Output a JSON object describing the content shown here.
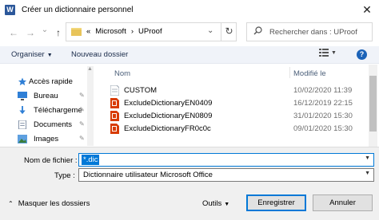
{
  "window": {
    "app_icon_letter": "W",
    "title": "Créer un dictionnaire personnel",
    "close_symbol": "✕"
  },
  "navigation": {
    "back_symbol": "←",
    "forward_symbol": "→",
    "history_symbol": "⌄",
    "up_symbol": "↑",
    "breadcrumb": [
      "«",
      "Microsoft",
      "›",
      "UProof"
    ],
    "refresh_symbol": "↻",
    "search_placeholder": "Rechercher dans : UProof"
  },
  "toolbar": {
    "organize_label": "Organiser",
    "new_folder_label": "Nouveau dossier",
    "help_symbol": "?"
  },
  "nav_pane": {
    "items": [
      {
        "label": "Accès rapide",
        "icon": "star-icon",
        "pinned": false
      },
      {
        "label": "Bureau",
        "icon": "desktop-icon",
        "pinned": true
      },
      {
        "label": "Téléchargeme",
        "icon": "download-icon",
        "pinned": true
      },
      {
        "label": "Documents",
        "icon": "documents-icon",
        "pinned": true
      },
      {
        "label": "Images",
        "icon": "images-icon",
        "pinned": true
      }
    ],
    "pin_symbol": "📌"
  },
  "file_list": {
    "columns": {
      "name": "Nom",
      "date": "Modifié le"
    },
    "files": [
      {
        "name": "CUSTOM",
        "date": "10/02/2020 11:39",
        "icon": "text-file-icon"
      },
      {
        "name": "ExcludeDictionaryEN0409",
        "date": "16/12/2019 22:15",
        "icon": "office-file-icon"
      },
      {
        "name": "ExcludeDictionaryEN0809",
        "date": "31/01/2020 15:30",
        "icon": "office-file-icon"
      },
      {
        "name": "ExcludeDictionaryFR0c0c",
        "date": "09/01/2020 15:30",
        "icon": "office-file-icon"
      }
    ]
  },
  "form": {
    "filename_label": "Nom de fichier :",
    "filename_value": "*.dic",
    "type_label": "Type :",
    "type_value": "Dictionnaire utilisateur Microsoft Office"
  },
  "footer": {
    "hide_folders_label": "Masquer les dossiers",
    "tools_label": "Outils",
    "save_label": "Enregistrer",
    "cancel_label": "Annuler"
  },
  "colors": {
    "accent": "#0078d7",
    "word_blue": "#2b579a",
    "office_orange": "#d83b01"
  }
}
